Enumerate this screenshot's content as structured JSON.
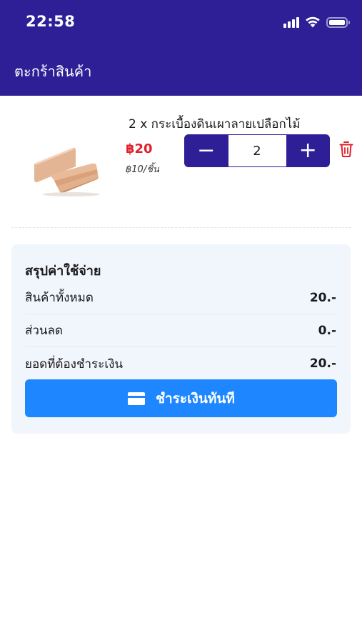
{
  "status_bar": {
    "time": "22:58",
    "icons": [
      "cellular-signal-icon",
      "wifi-icon",
      "battery-icon"
    ]
  },
  "header": {
    "title": "ตะกร้าสินค้า",
    "background_color": "#2e1f96"
  },
  "cart": {
    "items": [
      {
        "name": "2 x กระเบื้องดินเผาลายเปลือกไม้",
        "price": "฿20",
        "unit_price": "฿10/ชิ้น",
        "quantity": "2",
        "decrement_label": "−",
        "increment_label": "+",
        "thumbnail_icon": "clay-tile-product-image",
        "remove_icon": "trash-icon"
      }
    ]
  },
  "summary": {
    "title": "สรุปค่าใช้จ่าย",
    "rows": [
      {
        "label": "สินค้าทั้งหมด",
        "value": "20.-"
      },
      {
        "label": "ส่วนลด",
        "value": "0.-"
      },
      {
        "label": "ยอดที่ต้องชำระเงิน",
        "value": "20.-"
      }
    ],
    "pay_button": {
      "label": "ชำระเงินทันที",
      "icon": "credit-card-icon",
      "color": "#1e87ff"
    }
  },
  "colors": {
    "price_red": "#e0202a",
    "summary_background": "#f1f5fc"
  }
}
